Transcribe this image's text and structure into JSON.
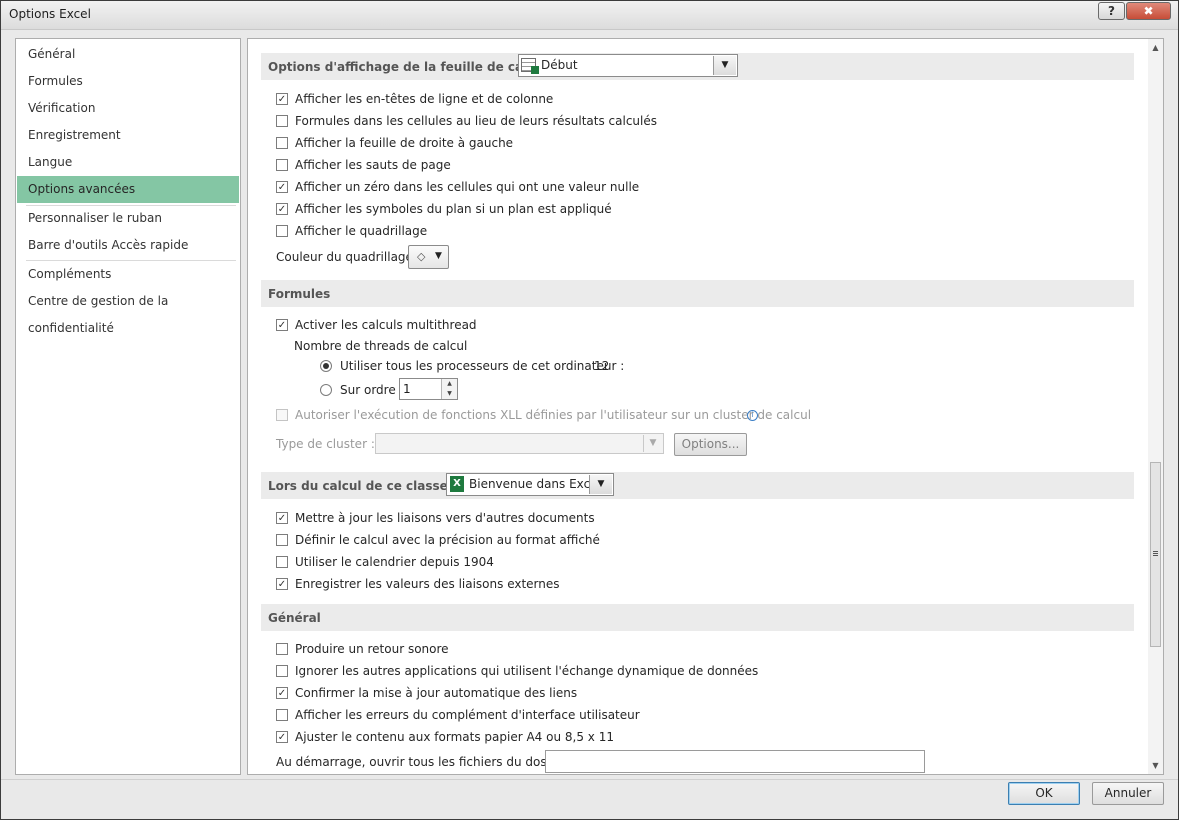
{
  "window": {
    "title": "Options Excel",
    "help": "?",
    "close": "✖"
  },
  "sidebar": {
    "items": [
      {
        "label": "Général"
      },
      {
        "label": "Formules"
      },
      {
        "label": "Vérification"
      },
      {
        "label": "Enregistrement"
      },
      {
        "label": "Langue"
      },
      {
        "label": "Options avancées",
        "active": true
      },
      {
        "label": "Personnaliser le ruban"
      },
      {
        "label": "Barre d'outils Accès rapide"
      },
      {
        "label": "Compléments"
      },
      {
        "label": "Centre de gestion de la confidentialité"
      }
    ]
  },
  "sheet_display": {
    "header": "Options d'affichage de la feuille de calcul :",
    "selected_sheet": "Début",
    "options": [
      {
        "label": "Afficher les en-têtes de ligne et de colonne",
        "checked": true
      },
      {
        "label": "Formules dans les cellules au lieu de leurs résultats calculés",
        "checked": false
      },
      {
        "label": "Afficher la feuille de droite à gauche",
        "checked": false
      },
      {
        "label": "Afficher les sauts de page",
        "checked": false
      },
      {
        "label": "Afficher un zéro dans les cellules qui ont une valeur nulle",
        "checked": true
      },
      {
        "label": "Afficher les symboles du plan si un plan est appliqué",
        "checked": true
      },
      {
        "label": "Afficher le quadrillage",
        "checked": false
      }
    ],
    "grid_color_label": "Couleur du quadrillage"
  },
  "formulas": {
    "header": "Formules",
    "multithread": {
      "label": "Activer les calculs multithread",
      "checked": true
    },
    "threads_label": "Nombre de threads de calcul",
    "use_all": {
      "label": "Utiliser tous les processeurs de cet ordinateur :",
      "value": "12",
      "selected": true
    },
    "manual": {
      "label": "Sur ordre",
      "value": "1",
      "selected": false
    },
    "xll": {
      "label": "Autoriser l'exécution de fonctions XLL définies par l'utilisateur sur un cluster de calcul",
      "checked": false
    },
    "cluster_type_label": "Type de cluster :",
    "options_button": "Options..."
  },
  "workbook_calc": {
    "header": "Lors du calcul de ce classeur :",
    "selected_workbook": "Bienvenue dans Exc...",
    "options": [
      {
        "label": "Mettre à jour les liaisons vers d'autres documents",
        "checked": true
      },
      {
        "label": "Définir le calcul avec la précision au format affiché",
        "checked": false
      },
      {
        "label": "Utiliser le calendrier depuis 1904",
        "checked": false
      },
      {
        "label": "Enregistrer les valeurs des liaisons externes",
        "checked": true
      }
    ]
  },
  "general": {
    "header": "Général",
    "options": [
      {
        "label": "Produire un retour sonore",
        "checked": false
      },
      {
        "label": "Ignorer les autres applications qui utilisent l'échange dynamique de données",
        "checked": false
      },
      {
        "label": "Confirmer la mise à jour automatique des liens",
        "checked": true
      },
      {
        "label": "Afficher les erreurs du complément d'interface utilisateur",
        "checked": false
      },
      {
        "label": "Ajuster le contenu aux formats papier A4 ou 8,5 x 11",
        "checked": true
      }
    ],
    "startup_label": "Au démarrage, ouvrir tous les fichiers du dossier :",
    "startup_value": ""
  },
  "footer": {
    "ok": "OK",
    "cancel": "Annuler"
  },
  "icons": {
    "sheet": "worksheet-icon",
    "excel": "excel-icon",
    "bucket": "paint-bucket-icon",
    "info": "info-icon"
  }
}
